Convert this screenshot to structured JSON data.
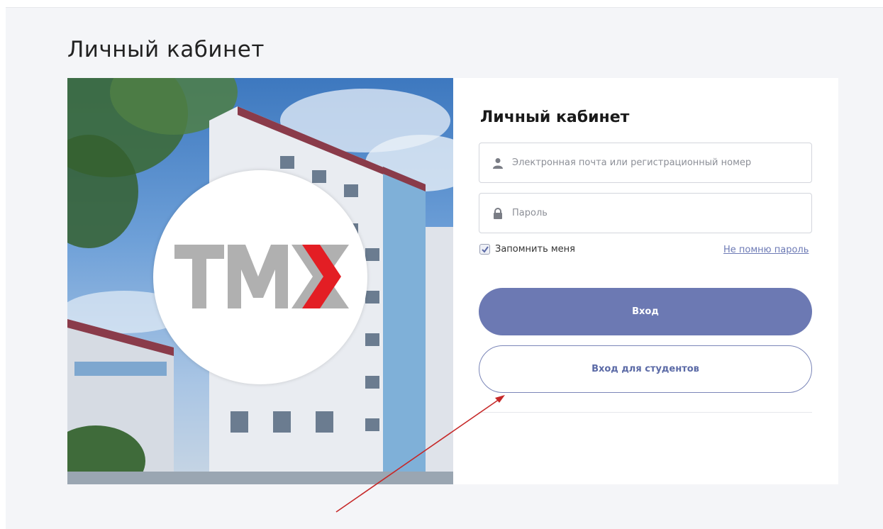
{
  "page": {
    "title": "Личный кабинет"
  },
  "photo": {
    "logo_text": "ТМК"
  },
  "form": {
    "title": "Личный кабинет",
    "email_placeholder": "Электронная почта или регистрационный номер",
    "password_placeholder": "Пароль",
    "remember_label": "Запомнить меня",
    "remember_checked": true,
    "forgot_label": "Не помню пароль",
    "login_button": "Вход",
    "student_login_button": "Вход для студентов"
  },
  "icons": {
    "email_field": "user-icon",
    "password_field": "lock-icon",
    "remember": "check-icon"
  },
  "colors": {
    "accent": "#6c79b3",
    "link": "#6d7ab5",
    "logo_grey": "#b0b0b0",
    "logo_red": "#e31e24",
    "annotation_arrow": "#c62828"
  }
}
